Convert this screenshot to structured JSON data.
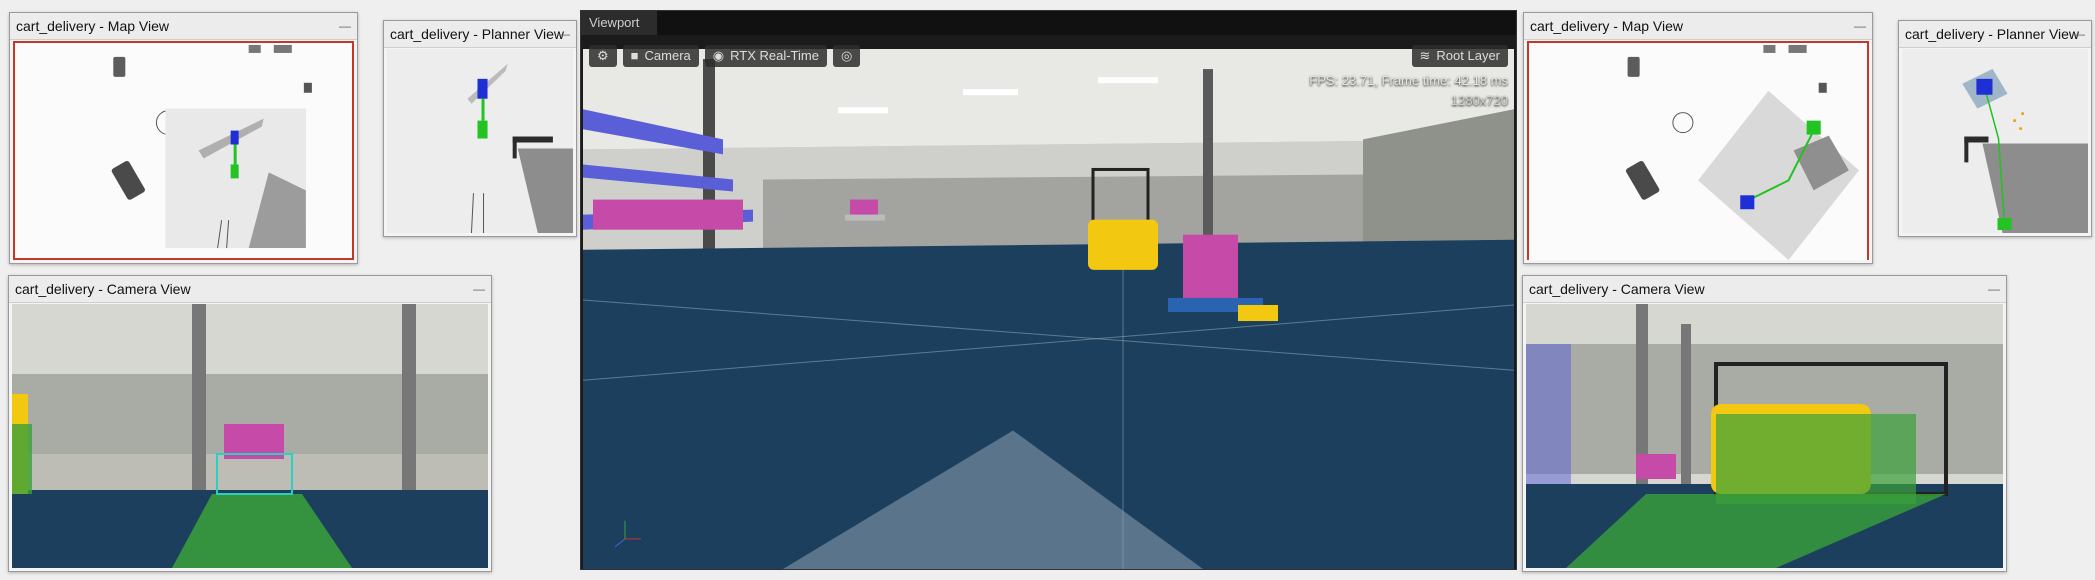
{
  "windows": {
    "left_map": {
      "title": "cart_delivery - Map View",
      "min": "—"
    },
    "left_planner": {
      "title": "cart_delivery - Planner View",
      "min": "—"
    },
    "left_camera": {
      "title": "cart_delivery - Camera View",
      "min": "—"
    },
    "right_map": {
      "title": "cart_delivery - Map View",
      "min": "—"
    },
    "right_planner": {
      "title": "cart_delivery - Planner View",
      "min": "—"
    },
    "right_camera": {
      "title": "cart_delivery - Camera View",
      "min": "—"
    }
  },
  "viewport": {
    "tab": "Viewport",
    "toolbar": {
      "settings_icon": "gear-icon",
      "camera_label": "Camera",
      "render_label": "RTX Real-Time",
      "visibility_icon": "eye-icon"
    },
    "root_layer_label": "Root Layer",
    "stats": {
      "fps_line": "FPS: 23.71, Frame time: 42.18 ms",
      "resolution": "1280x720"
    }
  },
  "colors": {
    "robot_blue": "#1f2fd6",
    "path_green": "#22c322",
    "floor_blue": "#1c3f5e",
    "forklift_yellow": "#f2c811",
    "pallet_magenta": "#c64aa8"
  }
}
